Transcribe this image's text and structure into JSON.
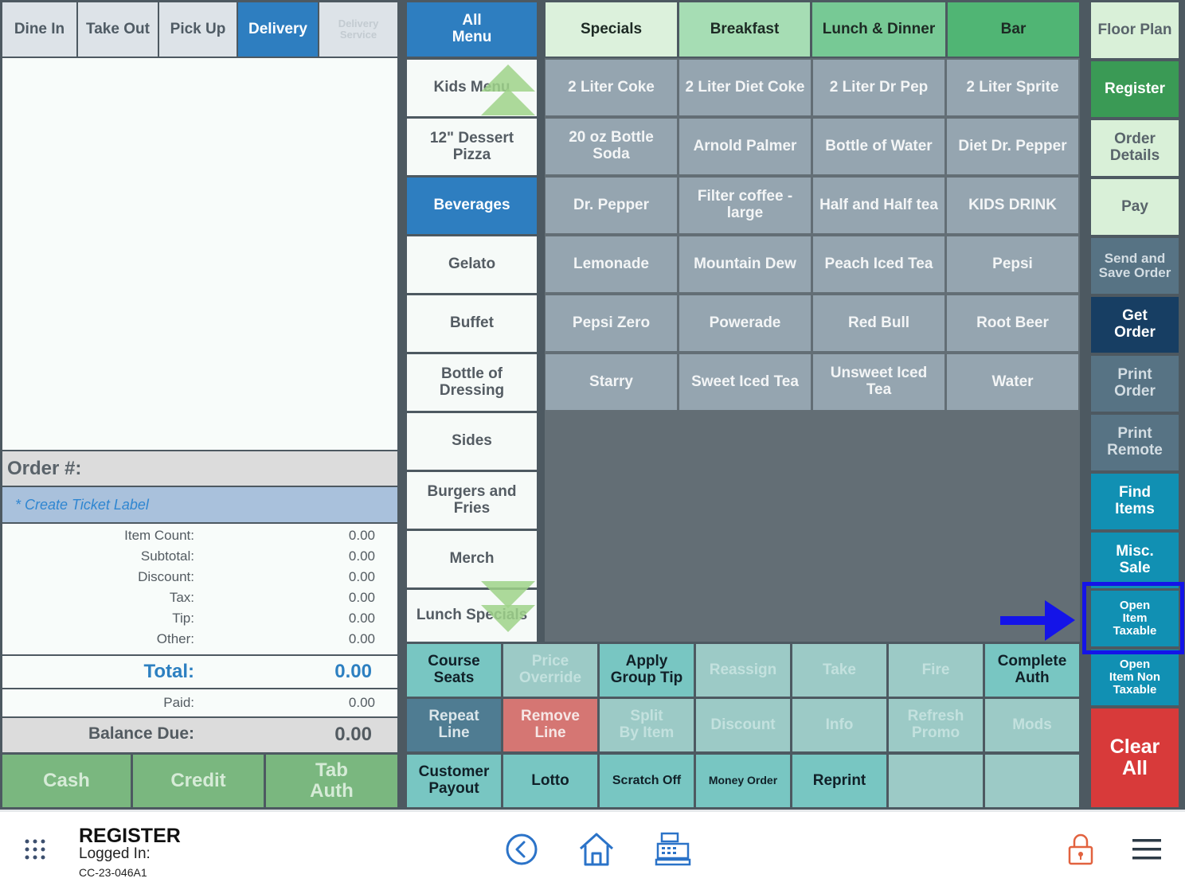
{
  "order_types": {
    "dine_in": "Dine In",
    "take_out": "Take Out",
    "pick_up": "Pick Up",
    "delivery": "Delivery",
    "delivery_service": "Delivery\nService"
  },
  "order": {
    "number_label": "Order #:",
    "ticket_label_placeholder": "* Create Ticket Label",
    "totals": [
      {
        "label": "Item Count:",
        "value": "0.00"
      },
      {
        "label": "Subtotal:",
        "value": "0.00"
      },
      {
        "label": "Discount:",
        "value": "0.00"
      },
      {
        "label": "Tax:",
        "value": "0.00"
      },
      {
        "label": "Tip:",
        "value": "0.00"
      },
      {
        "label": "Other:",
        "value": "0.00"
      }
    ],
    "total_label": "Total:",
    "total_value": "0.00",
    "paid_label": "Paid:",
    "paid_value": "0.00",
    "balance_label": "Balance Due:",
    "balance_value": "0.00"
  },
  "payment": {
    "cash": "Cash",
    "credit": "Credit",
    "tab_auth": "Tab\nAuth"
  },
  "categories": {
    "all_menu": "All\nMenu",
    "items": [
      "Kids Menu",
      "12\" Dessert\nPizza",
      "Beverages",
      "Gelato",
      "Buffet",
      "Bottle of\nDressing",
      "Sides",
      "Burgers and\nFries",
      "Merch",
      "Lunch Specials"
    ],
    "active_index": 2
  },
  "menu_tabs": [
    "Specials",
    "Breakfast",
    "Lunch & Dinner",
    "Bar"
  ],
  "menu_tab_colors": [
    "#dcf1dc",
    "#a6ddb4",
    "#77c995",
    "#50b574"
  ],
  "items": [
    "2 Liter Coke",
    "2 Liter Diet Coke",
    "2 Liter Dr Pep",
    "2 Liter Sprite",
    "20 oz Bottle\nSoda",
    "Arnold Palmer",
    "Bottle of Water",
    "Diet Dr. Pepper",
    "Dr. Pepper",
    "Filter coffee -\nlarge",
    "Half and Half tea",
    "KIDS DRINK",
    "Lemonade",
    "Mountain Dew",
    "Peach Iced Tea",
    "Pepsi",
    "Pepsi Zero",
    "Powerade",
    "Red Bull",
    "Root Beer",
    "Starry",
    "Sweet Iced Tea",
    "Unsweet Iced Tea",
    "Water"
  ],
  "actions": {
    "course_seats": "Course\nSeats",
    "price_override": "Price\nOverride",
    "apply_group_tip": "Apply\nGroup Tip",
    "reassign": "Reassign",
    "take": "Take",
    "fire": "Fire",
    "complete_auth": "Complete\nAuth",
    "repeat_line": "Repeat\nLine",
    "remove_line": "Remove\nLine",
    "split_by_item": "Split\nBy Item",
    "discount": "Discount",
    "info": "Info",
    "refresh_promo": "Refresh\nPromo",
    "mods": "Mods",
    "customer_payout": "Customer\nPayout",
    "lotto": "Lotto",
    "scratch_off": "Scratch Off",
    "money_order": "Money Order",
    "reprint": "Reprint"
  },
  "sidebar": {
    "floor_plan": "Floor Plan",
    "register": "Register",
    "order_details": "Order\nDetails",
    "pay": "Pay",
    "send_save": "Send and\nSave Order",
    "get_order": "Get\nOrder",
    "print_order": "Print\nOrder",
    "print_remote": "Print\nRemote",
    "find_items": "Find\nItems",
    "misc_sale": "Misc.\nSale",
    "open_item_taxable": "Open\nItem\nTaxable",
    "open_item_non_taxable": "Open\nItem Non\nTaxable",
    "clear_all": "Clear\nAll"
  },
  "footer": {
    "title": "REGISTER",
    "logged_in": "Logged In:",
    "device_id": "CC-23-046A1",
    "icons": [
      "apps-grid-icon",
      "back-icon",
      "home-icon",
      "register-icon",
      "lock-icon",
      "menu-icon"
    ]
  },
  "colors": {
    "accent_blue": "#2e7ec0",
    "highlight_blue": "#1414e8",
    "clear_red": "#d83a3a"
  }
}
